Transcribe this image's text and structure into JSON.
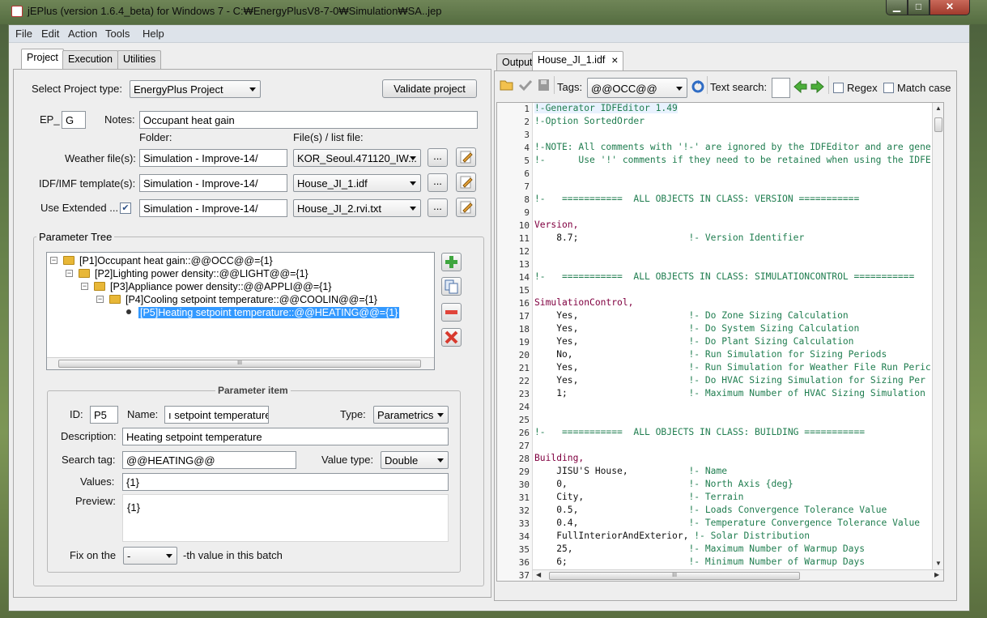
{
  "window": {
    "title": "jEPlus (version 1.6.4_beta) for Windows 7 - C:₩EnergyPlusV8-7-0₩Simulation₩SA..jep",
    "minimize_glyph": "▁",
    "maximize_glyph": "□",
    "close_glyph": "✕"
  },
  "menu": [
    "File",
    "Edit",
    "Action",
    "Tools",
    "Help"
  ],
  "left_tabs": [
    "Project",
    "Execution",
    "Utilities"
  ],
  "project": {
    "select_type_label": "Select Project type:",
    "project_type": "EnergyPlus Project",
    "validate_label": "Validate project",
    "ep_label": "EP_",
    "ep_value": "G",
    "notes_label": "Notes:",
    "notes_value": "Occupant heat gain",
    "folder_header": "Folder:",
    "files_header": "File(s) / list file:",
    "weather_label": "Weather file(s):",
    "weather_folder": "Simulation - Improve-14/",
    "weather_file": "KOR_Seoul.471120_IW...",
    "idf_label": "IDF/IMF template(s):",
    "idf_folder": "Simulation - Improve-14/",
    "idf_file": "House_JI_1.idf",
    "ext_label": "Use Extended ...",
    "ext_checked": "✔",
    "ext_folder": "Simulation - Improve-14/",
    "ext_file": "House_JI_2.rvi.txt",
    "browse_label": "...",
    "tree_title": "Parameter Tree",
    "tree": [
      "[P1]Occupant heat gain::@@OCC@@={1}",
      "[P2]Lighting power density::@@LIGHT@@={1}",
      "[P3]Appliance power density::@@APPLI@@={1}",
      "[P4]Cooling setpoint temperature::@@COOLIN@@={1}",
      "[P5]Heating setpoint temperature::@@HEATING@@={1}"
    ],
    "scroll_grip": "III"
  },
  "param_item": {
    "title": "Parameter item",
    "id_label": "ID:",
    "id_value": "P5",
    "name_label": "Name:",
    "name_value": "ı setpoint temperature",
    "type_label": "Type:",
    "type_value": "Parametrics",
    "desc_label": "Description:",
    "desc_value": "Heating setpoint temperature",
    "search_label": "Search tag:",
    "search_value": "@@HEATING@@",
    "vtype_label": "Value type:",
    "vtype_value": "Double",
    "values_label": "Values:",
    "values_value": "{1}",
    "preview_label": "Preview:",
    "preview_value": "{1}",
    "fix_label": "Fix on the",
    "fix_value": "-",
    "fix_suffix": "-th value in this batch"
  },
  "right_tabs": [
    "Output",
    "House_JI_1.idf"
  ],
  "tab_close": "×",
  "editor": {
    "tags_label": "Tags:",
    "tags_value": "@@OCC@@",
    "search_label": "Text search:",
    "regex_label": "Regex",
    "match_case_label": "Match case",
    "lines": [
      {
        "n": "1",
        "t": "!-Generator IDFEditor 1.49",
        "k": "com"
      },
      {
        "n": "2",
        "t": "!-Option SortedOrder",
        "k": "com"
      },
      {
        "n": "3",
        "t": "",
        "k": ""
      },
      {
        "n": "4",
        "t": "!-NOTE: All comments with '!-' are ignored by the IDFEditor and are gene",
        "k": "com"
      },
      {
        "n": "5",
        "t": "!-      Use '!' comments if they need to be retained when using the IDFE",
        "k": "com"
      },
      {
        "n": "6",
        "t": "",
        "k": ""
      },
      {
        "n": "7",
        "t": "",
        "k": ""
      },
      {
        "n": "8",
        "t": "!-   ===========  ALL OBJECTS IN CLASS: VERSION ===========",
        "k": "com"
      },
      {
        "n": "9",
        "t": "",
        "k": ""
      },
      {
        "n": "10",
        "t": "Version,",
        "k": "kw"
      },
      {
        "n": "11",
        "t": "    8.7;                    !- Version Identifier",
        "k": "mix"
      },
      {
        "n": "12",
        "t": "",
        "k": ""
      },
      {
        "n": "13",
        "t": "",
        "k": ""
      },
      {
        "n": "14",
        "t": "!-   ===========  ALL OBJECTS IN CLASS: SIMULATIONCONTROL ===========",
        "k": "com"
      },
      {
        "n": "15",
        "t": "",
        "k": ""
      },
      {
        "n": "16",
        "t": "SimulationControl,",
        "k": "kw"
      },
      {
        "n": "17",
        "t": "    Yes,                    !- Do Zone Sizing Calculation",
        "k": "mix"
      },
      {
        "n": "18",
        "t": "    Yes,                    !- Do System Sizing Calculation",
        "k": "mix"
      },
      {
        "n": "19",
        "t": "    Yes,                    !- Do Plant Sizing Calculation",
        "k": "mix"
      },
      {
        "n": "20",
        "t": "    No,                     !- Run Simulation for Sizing Periods",
        "k": "mix"
      },
      {
        "n": "21",
        "t": "    Yes,                    !- Run Simulation for Weather File Run Peric",
        "k": "mix"
      },
      {
        "n": "22",
        "t": "    Yes,                    !- Do HVAC Sizing Simulation for Sizing Per",
        "k": "mix"
      },
      {
        "n": "23",
        "t": "    1;                      !- Maximum Number of HVAC Sizing Simulation",
        "k": "mix"
      },
      {
        "n": "24",
        "t": "",
        "k": ""
      },
      {
        "n": "25",
        "t": "",
        "k": ""
      },
      {
        "n": "26",
        "t": "!-   ===========  ALL OBJECTS IN CLASS: BUILDING ===========",
        "k": "com"
      },
      {
        "n": "27",
        "t": "",
        "k": ""
      },
      {
        "n": "28",
        "t": "Building,",
        "k": "kw"
      },
      {
        "n": "29",
        "t": "    JISU'S House,           !- Name",
        "k": "mix"
      },
      {
        "n": "30",
        "t": "    0,                      !- North Axis {deg}",
        "k": "mix"
      },
      {
        "n": "31",
        "t": "    City,                   !- Terrain",
        "k": "mix"
      },
      {
        "n": "32",
        "t": "    0.5,                    !- Loads Convergence Tolerance Value",
        "k": "mix"
      },
      {
        "n": "33",
        "t": "    0.4,                    !- Temperature Convergence Tolerance Value",
        "k": "mix"
      },
      {
        "n": "34",
        "t": "    FullInteriorAndExterior, !- Solar Distribution",
        "k": "mix"
      },
      {
        "n": "35",
        "t": "    25,                     !- Maximum Number of Warmup Days",
        "k": "mix"
      },
      {
        "n": "36",
        "t": "    6;                      !- Minimum Number of Warmup Days",
        "k": "mix"
      },
      {
        "n": "37",
        "t": "",
        "k": ""
      }
    ]
  }
}
